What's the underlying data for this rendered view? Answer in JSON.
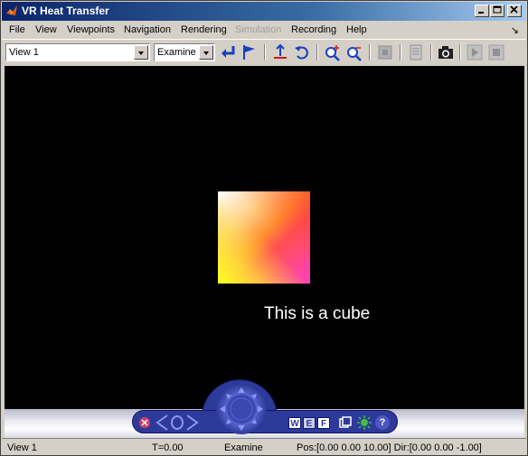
{
  "window": {
    "title": "VR Heat Transfer"
  },
  "menu": {
    "items": [
      {
        "label": "File",
        "enabled": true
      },
      {
        "label": "View",
        "enabled": true
      },
      {
        "label": "Viewpoints",
        "enabled": true
      },
      {
        "label": "Navigation",
        "enabled": true
      },
      {
        "label": "Rendering",
        "enabled": true
      },
      {
        "label": "Simulation",
        "enabled": false
      },
      {
        "label": "Recording",
        "enabled": true
      },
      {
        "label": "Help",
        "enabled": true
      }
    ]
  },
  "toolbar": {
    "viewpoint_value": "View 1",
    "navmode_value": "Examine"
  },
  "scene": {
    "label": "This is a cube",
    "background": "#000000"
  },
  "navpanel": {
    "w_label": "W",
    "e_label": "E",
    "f_label": "F",
    "help_label": "?"
  },
  "status": {
    "viewpoint": "View 1",
    "time": "T=0.00",
    "mode": "Examine",
    "pos_dir": "Pos:[0.00 0.00 10.00] Dir:[0.00 0.00 -1.00]"
  },
  "colors": {
    "title_start": "#0a246a",
    "title_end": "#a6caf0",
    "nav_blue": "#2e3a9a"
  }
}
